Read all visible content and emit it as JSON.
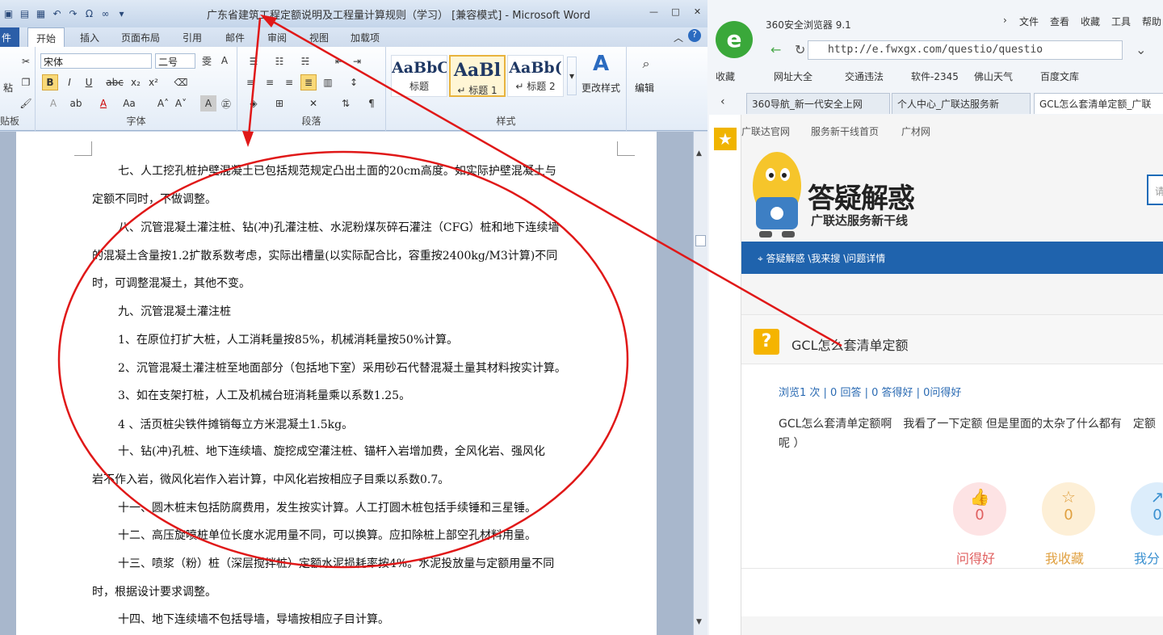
{
  "word": {
    "title": "广东省建筑工程定额说明及工程量计算规则（学习） [兼容模式] - Microsoft Word",
    "tabs": [
      "件",
      "开始",
      "插入",
      "页面布局",
      "引用",
      "邮件",
      "审阅",
      "视图",
      "加载项"
    ],
    "font": {
      "name": "宋体",
      "size": "二号"
    },
    "groups": {
      "clipboard": "贴板",
      "font": "字体",
      "paragraph": "段落",
      "styles": "样式"
    },
    "styles": [
      {
        "preview": "AaBbC",
        "label": "标题"
      },
      {
        "preview": "AaBl",
        "label": "↵ 标题 1"
      },
      {
        "preview": "AaBb(",
        "label": "↵ 标题 2"
      }
    ],
    "change_styles": "更改样式",
    "edit": "编辑",
    "paste": "粘",
    "doc_lines": [
      {
        "text": "七、人工挖孔桩护壁混凝土已包括规范规定凸出土面的20cm高度。如实际护壁混凝土与",
        "indent": true
      },
      {
        "text": "定额不同时，不做调整。",
        "indent": false
      },
      {
        "text": "八、沉管混凝土灌注桩、钻(冲)孔灌注桩、水泥粉煤灰碎石灌注（CFG）桩和地下连续墙",
        "indent": true
      },
      {
        "text": "的混凝土含量按1.2扩散系数考虑，实际出槽量(以实际配合比，容重按2400kg/M3计算)不同",
        "indent": false
      },
      {
        "text": "时，可调整混凝土，其他不变。",
        "indent": false
      },
      {
        "text": "九、沉管混凝土灌注桩",
        "indent": true
      },
      {
        "text": "1、在原位打扩大桩，人工消耗量按85%，机械消耗量按50%计算。",
        "indent": true
      },
      {
        "text": "2、沉管混凝土灌注桩至地面部分（包括地下室）采用砂石代替混凝土量其材料按实计算。",
        "indent": true
      },
      {
        "text": "3、如在支架打桩，人工及机械台班消耗量乘以系数1.25。",
        "indent": true
      },
      {
        "text": "4 、活页桩尖铁件摊销每立方米混凝土1.5kg。",
        "indent": true
      },
      {
        "text": "十、钻(冲)孔桩、地下连续墙、旋挖成空灌注桩、锚杆入岩增加费，全风化岩、强风化",
        "indent": true
      },
      {
        "text": "岩不作入岩，微风化岩作入岩计算，中风化岩按相应子目乘以系数0.7。",
        "indent": false
      },
      {
        "text": "十一、圆木桩末包括防腐费用，发生按实计算。人工打圆木桩包括手续锤和三星锤。",
        "indent": true
      },
      {
        "text": "十二、高压旋喷桩单位长度水泥用量不同，可以换算。应扣除桩上部空孔材料用量。",
        "indent": true
      },
      {
        "text": "十三、喷浆（粉）桩（深层搅拌桩）定额水泥损耗率按4%。水泥投放量与定额用量不同",
        "indent": true
      },
      {
        "text": "时，根据设计要求调整。",
        "indent": false
      },
      {
        "text": "十四、地下连续墙不包括导墙，导墙按相应子目计算。",
        "indent": true
      }
    ]
  },
  "browser": {
    "name": "360安全浏览器 9.1",
    "menu": [
      "文件",
      "查看",
      "收藏",
      "工具",
      "帮助"
    ],
    "url": "http://e.fwxgx.com/questio/questio",
    "bookmarks": [
      "收藏",
      "网址大全",
      "交通违法",
      "软件-2345",
      "佛山天气",
      "百度文库"
    ],
    "tabs": [
      "360导航_新一代安全上网",
      "个人中心_广联达服务新",
      "GCL怎么套清单定额_广联"
    ],
    "toplinks": [
      "广联达官网",
      "服务新干线首页",
      "广材网"
    ],
    "brand_title": "答疑解惑",
    "brand_sub": "广联达服务新干线",
    "search_placeholder": "请",
    "breadcrumb": "答疑解惑 \\我来搜 \\问题详情",
    "question_title": "GCL怎么套清单定额",
    "stats": "浏览1 次 | 0 回答 | 0 答得好 | 0问得好",
    "question_body": "GCL怎么套清单定额啊　我看了一下定额 但是里面的太杂了什么都有　定额呢 ）",
    "actions": [
      {
        "label": "问得好",
        "count": "0",
        "color": "#e06060",
        "bg": "#fde3e4"
      },
      {
        "label": "我收藏",
        "count": "0",
        "color": "#e0a040",
        "bg": "#fdefd6"
      },
      {
        "label": "我分",
        "count": "0",
        "color": "#3a90d0",
        "bg": "#dcedfb"
      }
    ]
  }
}
